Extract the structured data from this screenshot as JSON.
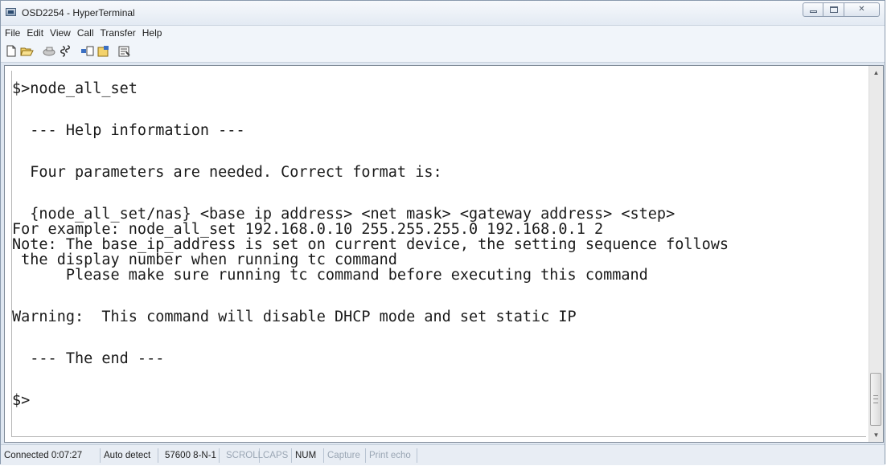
{
  "window": {
    "title": "OSD2254 - HyperTerminal"
  },
  "menubar": {
    "items": [
      "File",
      "Edit",
      "View",
      "Call",
      "Transfer",
      "Help"
    ]
  },
  "toolbar": {
    "icons": [
      "new-document-icon",
      "open-folder-icon",
      "call-icon",
      "disconnect-icon",
      "send-icon",
      "receive-icon",
      "properties-icon"
    ]
  },
  "terminal": {
    "lines": [
      "$>node_all_set",
      "",
      "  --- Help information ---",
      "",
      "  Four parameters are needed. Correct format is:",
      "",
      "  {node_all_set/nas} <base ip address> <net mask> <gateway address> <step>",
      "For example: node_all_set 192.168.0.10 255.255.255.0 192.168.0.1 2",
      "Note: The base_ip_address is set on current device, the setting sequence follows",
      " the display number when running tc command",
      "      Please make sure running tc command before executing this command",
      "",
      "Warning:  This command will disable DHCP mode and set static IP",
      "",
      "  --- The end ---",
      "",
      "$>"
    ]
  },
  "statusbar": {
    "connected": "Connected 0:07:27",
    "detect": "Auto detect",
    "settings": "57600 8-N-1",
    "scroll": "SCROLL",
    "caps": "CAPS",
    "num": "NUM",
    "capture": "Capture",
    "print_echo": "Print echo"
  }
}
